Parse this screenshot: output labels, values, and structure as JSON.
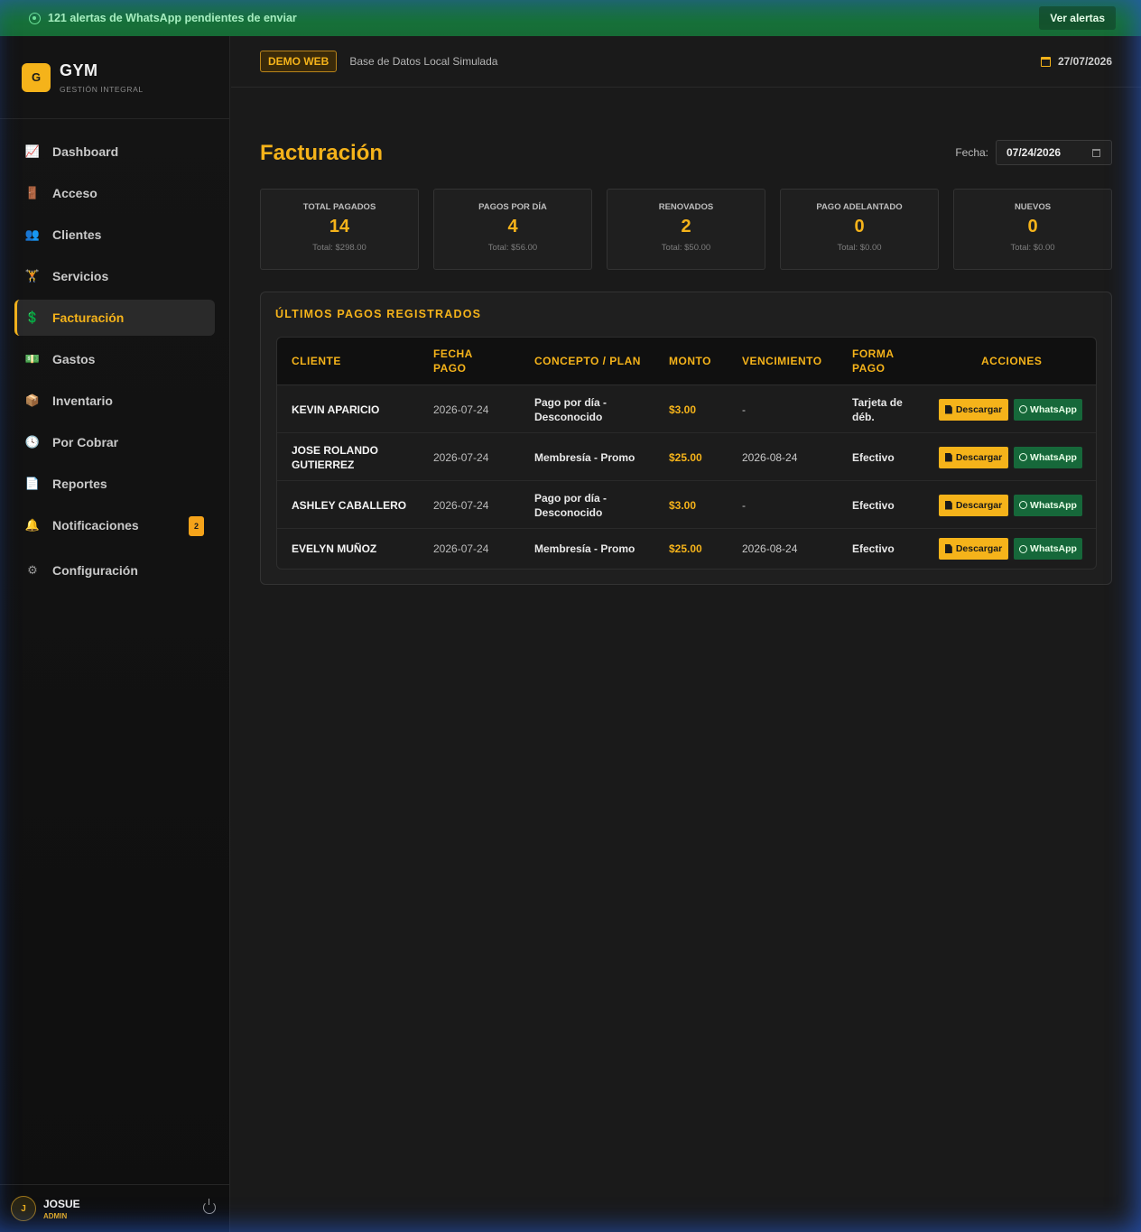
{
  "alert": {
    "text": "121 alertas de WhatsApp pendientes de enviar",
    "button": "Ver alertas"
  },
  "brand": {
    "logo": "G",
    "name": "GYM",
    "subtitle": "GESTIÓN INTEGRAL"
  },
  "sidebar": {
    "items": [
      {
        "label": "Dashboard",
        "icon": "chart-line-icon",
        "glyph": "📈"
      },
      {
        "label": "Acceso",
        "icon": "door-icon",
        "glyph": "🚪"
      },
      {
        "label": "Clientes",
        "icon": "users-icon",
        "glyph": "👥"
      },
      {
        "label": "Servicios",
        "icon": "dumbbell-icon",
        "glyph": "🏋"
      },
      {
        "label": "Facturación",
        "icon": "invoice-icon",
        "glyph": "💲"
      },
      {
        "label": "Gastos",
        "icon": "money-icon",
        "glyph": "💵"
      },
      {
        "label": "Inventario",
        "icon": "boxes-icon",
        "glyph": "📦"
      },
      {
        "label": "Por Cobrar",
        "icon": "clock-icon",
        "glyph": "🕓"
      },
      {
        "label": "Reportes",
        "icon": "file-pdf-icon",
        "glyph": "📄"
      },
      {
        "label": "Notificaciones",
        "icon": "bell-icon",
        "glyph": "🔔",
        "badge": "2"
      },
      {
        "label": "Configuración",
        "icon": "gears-icon",
        "glyph": "⚙"
      }
    ],
    "active": "Facturación"
  },
  "user": {
    "initial": "J",
    "name": "JOSUE",
    "role": "ADMIN"
  },
  "topbar": {
    "badge": "DEMO WEB",
    "db_text": "Base de Datos Local Simulada",
    "date": "27/07/2026"
  },
  "page": {
    "title": "Facturación",
    "date_label": "Fecha:",
    "date_value": "07/24/2026"
  },
  "cards": [
    {
      "label": "TOTAL PAGADOS",
      "value": "14",
      "total": "Total: $298.00"
    },
    {
      "label": "PAGOS POR DÍA",
      "value": "4",
      "total": "Total: $56.00"
    },
    {
      "label": "RENOVADOS",
      "value": "2",
      "total": "Total: $50.00"
    },
    {
      "label": "PAGO ADELANTADO",
      "value": "0",
      "total": "Total: $0.00"
    },
    {
      "label": "NUEVOS",
      "value": "0",
      "total": "Total: $0.00"
    }
  ],
  "payments": {
    "title": "ÚLTIMOS PAGOS REGISTRADOS",
    "columns": [
      "CLIENTE",
      "FECHA PAGO",
      "CONCEPTO / PLAN",
      "MONTO",
      "VENCIMIENTO",
      "FORMA PAGO",
      "ACCIONES"
    ],
    "download_label": "Descargar",
    "whatsapp_label": "WhatsApp",
    "rows": [
      {
        "cliente": "KEVIN APARICIO",
        "fecha": "2026-07-24",
        "concepto": "Pago por día - Desconocido",
        "monto": "$3.00",
        "vencimiento": "-",
        "forma": "Tarjeta de déb."
      },
      {
        "cliente": "JOSE ROLANDO GUTIERREZ",
        "fecha": "2026-07-24",
        "concepto": "Membresía - Promo",
        "monto": "$25.00",
        "vencimiento": "2026-08-24",
        "forma": "Efectivo"
      },
      {
        "cliente": "ASHLEY CABALLERO",
        "fecha": "2026-07-24",
        "concepto": "Pago por día - Desconocido",
        "monto": "$3.00",
        "vencimiento": "-",
        "forma": "Efectivo"
      },
      {
        "cliente": "EVELYN MUÑOZ",
        "fecha": "2026-07-24",
        "concepto": "Membresía - Promo",
        "monto": "$25.00",
        "vencimiento": "2026-08-24",
        "forma": "Efectivo"
      }
    ]
  },
  "colors": {
    "accent": "#f5b31a",
    "whatsapp": "#16683a",
    "background": "#1a1a1a"
  }
}
